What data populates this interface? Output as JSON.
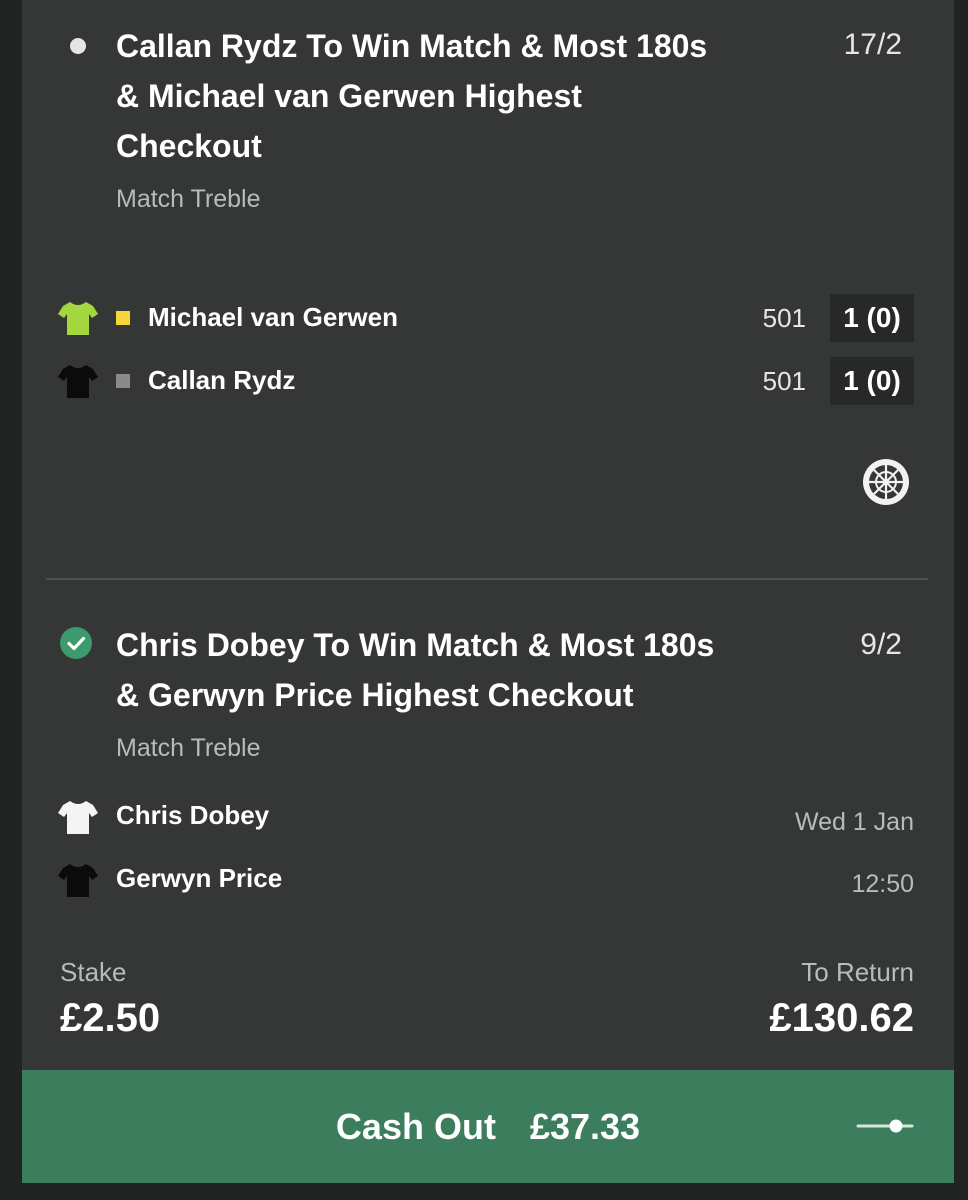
{
  "bets": [
    {
      "status": "open",
      "title_lines": [
        "Callan Rydz To Win Match & Most 180s",
        "& Michael van Gerwen Highest",
        "Checkout"
      ],
      "odds": "17/2",
      "market": "Match Treble",
      "players": [
        {
          "name": "Michael van Gerwen",
          "shirt_color": "#a4d63d",
          "serving_color": "#f5d63a",
          "score": "501",
          "legs": "1 (0)"
        },
        {
          "name": "Callan Rydz",
          "shirt_color": "#0b0b0b",
          "serving_color": "#8a8a8a",
          "score": "501",
          "legs": "1 (0)"
        }
      ],
      "sport_icon": "dartboard-icon"
    },
    {
      "status": "won",
      "title_lines": [
        "Chris Dobey To Win Match & Most 180s",
        "& Gerwyn Price Highest Checkout"
      ],
      "odds": "9/2",
      "market": "Match Treble",
      "players": [
        {
          "name": "Chris Dobey",
          "shirt_color": "#f4f4f4"
        },
        {
          "name": "Gerwyn Price",
          "shirt_color": "#0b0b0b"
        }
      ],
      "date": "Wed 1 Jan",
      "time": "12:50"
    }
  ],
  "stake": {
    "label": "Stake",
    "value": "£2.50"
  },
  "to_return": {
    "label": "To Return",
    "value": "£130.62"
  },
  "cash_out": {
    "label": "Cash Out",
    "amount": "£37.33",
    "button_color": "#3c7d5d",
    "slider_icon": "partial-cashout-slider-icon"
  },
  "colors": {
    "background": "#222423",
    "card": "#343735",
    "success": "#3c9a6c"
  }
}
